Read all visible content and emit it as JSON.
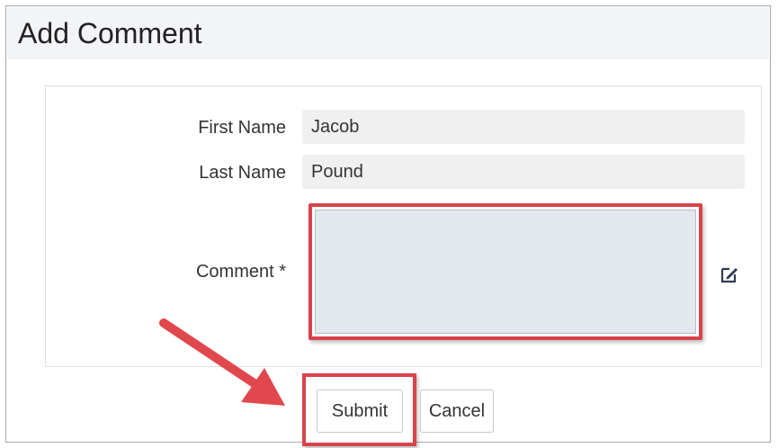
{
  "header": {
    "title": "Add Comment"
  },
  "form": {
    "first_name": {
      "label": "First Name",
      "value": "Jacob"
    },
    "last_name": {
      "label": "Last Name",
      "value": "Pound"
    },
    "comment": {
      "label": "Comment *",
      "value": "",
      "icon": "edit-icon"
    }
  },
  "actions": {
    "submit_label": "Submit",
    "cancel_label": "Cancel"
  },
  "annotation": {
    "highlight_color": "#d9434a",
    "arrow_color": "#e0484d"
  }
}
